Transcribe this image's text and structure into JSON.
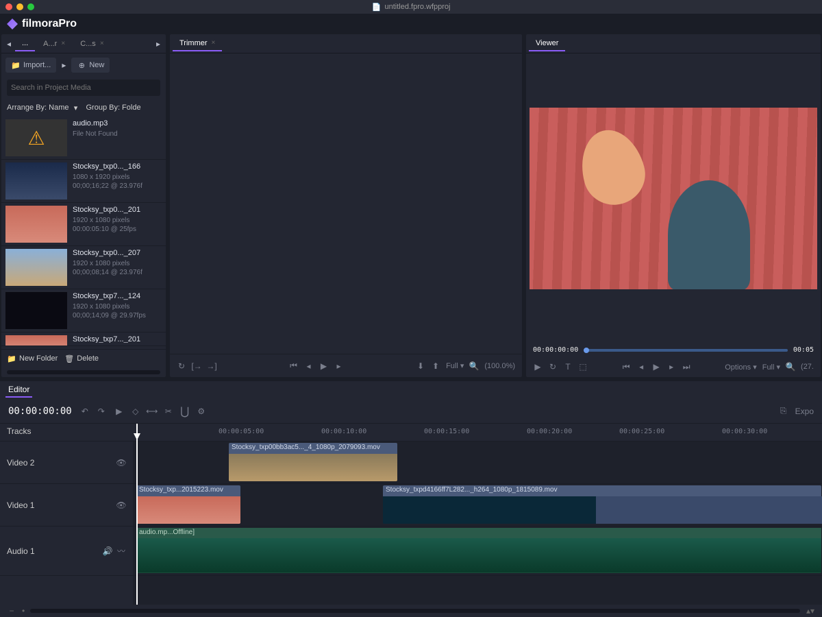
{
  "titlebar": {
    "filename": "untitled.fpro.wfpproj"
  },
  "app": {
    "name": "filmoraPro"
  },
  "media_panel": {
    "tabs": [
      {
        "label": "...",
        "closable": false
      },
      {
        "label": "A...r",
        "closable": true
      },
      {
        "label": "C...s",
        "closable": true
      }
    ],
    "import_label": "Import...",
    "new_label": "New",
    "search_placeholder": "Search in Project Media",
    "arrange_label": "Arrange By: Name",
    "group_label": "Group By: Folde",
    "items": [
      {
        "name": "audio.mp3",
        "meta1": "File Not Found",
        "meta2": "",
        "thumb": "warning"
      },
      {
        "name": "Stocksy_txp0..._166",
        "meta1": "1080 x 1920 pixels",
        "meta2": "00;00;16;22 @ 23.976f",
        "thumb": "sky"
      },
      {
        "name": "Stocksy_txp0..._201",
        "meta1": "1920 x 1080 pixels",
        "meta2": "00:00:05:10 @ 25fps",
        "thumb": "paddle"
      },
      {
        "name": "Stocksy_txp0..._207",
        "meta1": "1920 x 1080 pixels",
        "meta2": "00;00;08;14 @ 23.976f",
        "thumb": "hiker"
      },
      {
        "name": "Stocksy_txp7..._124",
        "meta1": "1920 x 1080 pixels",
        "meta2": "00;00;14;09 @ 29.97fps",
        "thumb": "dark"
      },
      {
        "name": "Stocksy_txp7..._201",
        "meta1": "",
        "meta2": "",
        "thumb": "paddle"
      }
    ],
    "new_folder_label": "New Folder",
    "delete_label": "Delete"
  },
  "trimmer": {
    "tab_label": "Trimmer",
    "quality_label": "Full",
    "zoom_label": "(100.0%)"
  },
  "viewer": {
    "tab_label": "Viewer",
    "timecode": "00:00:00:00",
    "end_timecode": "00:05",
    "options_label": "Options",
    "quality_label": "Full",
    "zoom_label": "(27."
  },
  "editor": {
    "tab_label": "Editor",
    "timecode": "00:00:00:00",
    "export_label": "Expo",
    "tracks_header": "Tracks",
    "ruler": [
      "00:00:05:00",
      "00:00:10:00",
      "00:00:15:00",
      "00:00:20:00",
      "00:00:25:00",
      "00:00:30:00"
    ],
    "tracks": [
      {
        "name": "Video 2"
      },
      {
        "name": "Video 1"
      },
      {
        "name": "Audio 1"
      }
    ],
    "clips": {
      "v2_1": "Stocksy_txp00bb3ac5..._4_1080p_2079093.mov",
      "v1_1": "Stocksy_txp...2015223.mov",
      "v1_2": "Stocksy_txpd4166ff7L282..._h264_1080p_1815089.mov",
      "a1_1": "audio.mp...Offline]"
    }
  }
}
